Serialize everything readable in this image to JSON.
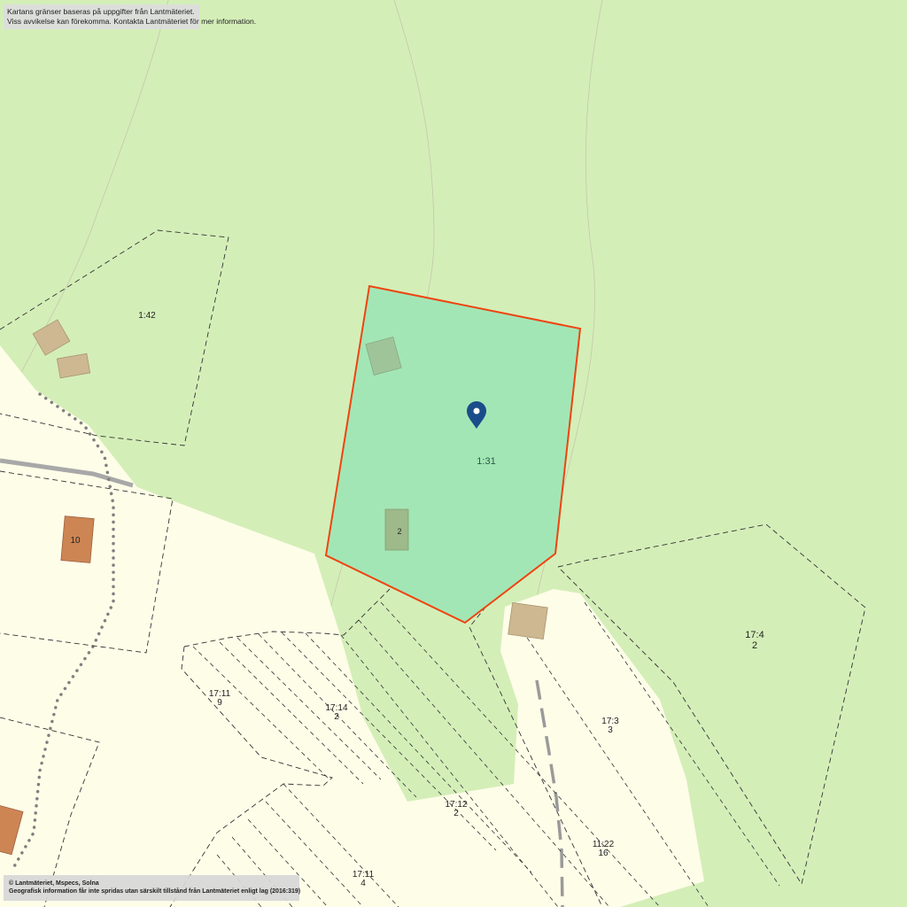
{
  "notice": {
    "line1": "Kartans gränser baseras på uppgifter från Lantmäteriet.",
    "line2": "Viss avvikelse kan förekomma. Kontakta Lantmäteriet för mer information."
  },
  "credits": {
    "line1": "© Lantmäteriet, Mspecs, Solna",
    "line2": "Geografisk information får inte spridas utan särskilt tillstånd från Lantmäteriet enligt lag (2016:319)"
  },
  "parcels": {
    "p1_42": "1:42",
    "p1_31": "1:31",
    "p17_4_a": "17:4",
    "p17_4_b": "2",
    "p17_11_9_a": "17:11",
    "p17_11_9_b": "9",
    "p17_14_a": "17:14",
    "p17_14_b": "2",
    "p17_3_a": "17:3",
    "p17_3_b": "3",
    "p17_12_a": "17:12",
    "p17_12_b": "2",
    "p11_22_a": "11:22",
    "p11_22_b": "16",
    "p17_11_4_a": "17:11",
    "p17_11_4_b": "4"
  },
  "buildings": {
    "house_10": "10",
    "house_2": "2"
  },
  "colors": {
    "forest": "#d4eeb8",
    "open_land": "#fefde8",
    "selected_fill": "#a3e6b5",
    "selected_border": "#ee4411",
    "building": "#cdb892",
    "house": "#cd8554",
    "pin": "#1a4d8a"
  },
  "icons": {
    "pin": "location-pin-icon"
  }
}
